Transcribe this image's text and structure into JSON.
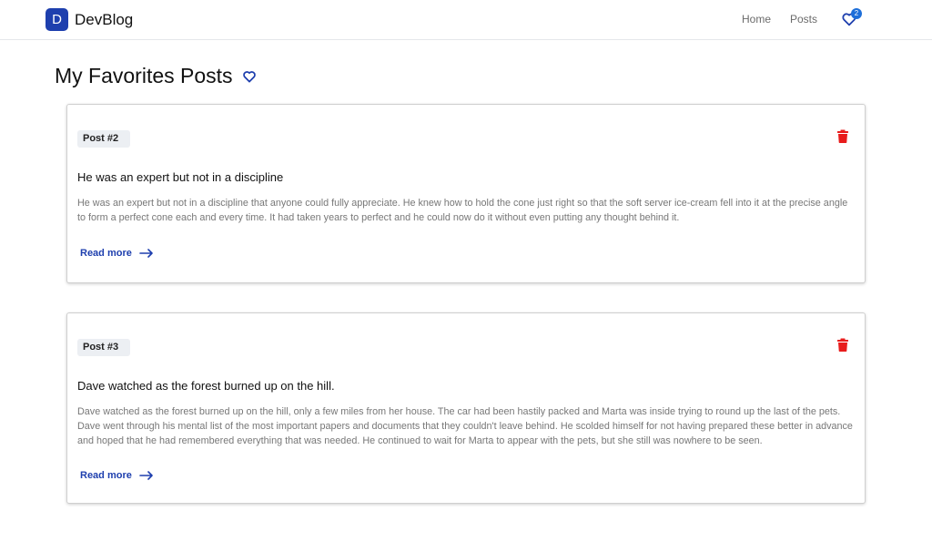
{
  "navbar": {
    "logo_letter": "D",
    "brand": "DevBlog",
    "links": [
      {
        "label": "Home"
      },
      {
        "label": "Posts"
      }
    ],
    "favorites_count": "2"
  },
  "page": {
    "title": "My Favorites Posts"
  },
  "posts": [
    {
      "badge": "Post #2",
      "title": "He was an expert but not in a discipline",
      "body": "He was an expert but not in a discipline that anyone could fully appreciate. He knew how to hold the cone just right so that the soft server ice-cream fell into it at the precise angle to form a perfect cone each and every time. It had taken years to perfect and he could now do it without even putting any thought behind it.",
      "read_more": "Read more"
    },
    {
      "badge": "Post #3",
      "title": "Dave watched as the forest burned up on the hill.",
      "body": "Dave watched as the forest burned up on the hill, only a few miles from her house. The car had been hastily packed and Marta was inside trying to round up the last of the pets. Dave went through his mental list of the most important papers and documents that they couldn't leave behind. He scolded himself for not having prepared these better in advance and hoped that he had remembered everything that was needed. He continued to wait for Marta to appear with the pets, but she still was nowhere to be seen.",
      "read_more": "Read more"
    }
  ],
  "colors": {
    "accent": "#1e3fae",
    "delete": "#e81c1c",
    "badge_bg": "#eceff3"
  },
  "icons": {
    "heart": "heart-outline-icon",
    "delete": "trash-icon",
    "arrow": "arrow-right-icon"
  }
}
